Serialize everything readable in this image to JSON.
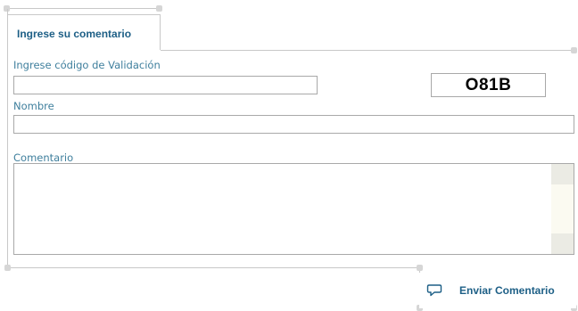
{
  "tab": {
    "label": "Ingrese su comentario"
  },
  "validation": {
    "label": "Ingrese código de Validación",
    "value": "",
    "code": "O81B"
  },
  "name": {
    "label": "Nombre",
    "value": ""
  },
  "comment": {
    "label": "Comentario",
    "value": ""
  },
  "submit": {
    "label": "Enviar Comentario",
    "icon": "speech-bubble-icon"
  },
  "colors": {
    "accent": "#1d5f86",
    "label_text": "#3f7f9d",
    "border": "#c8c8c8"
  }
}
